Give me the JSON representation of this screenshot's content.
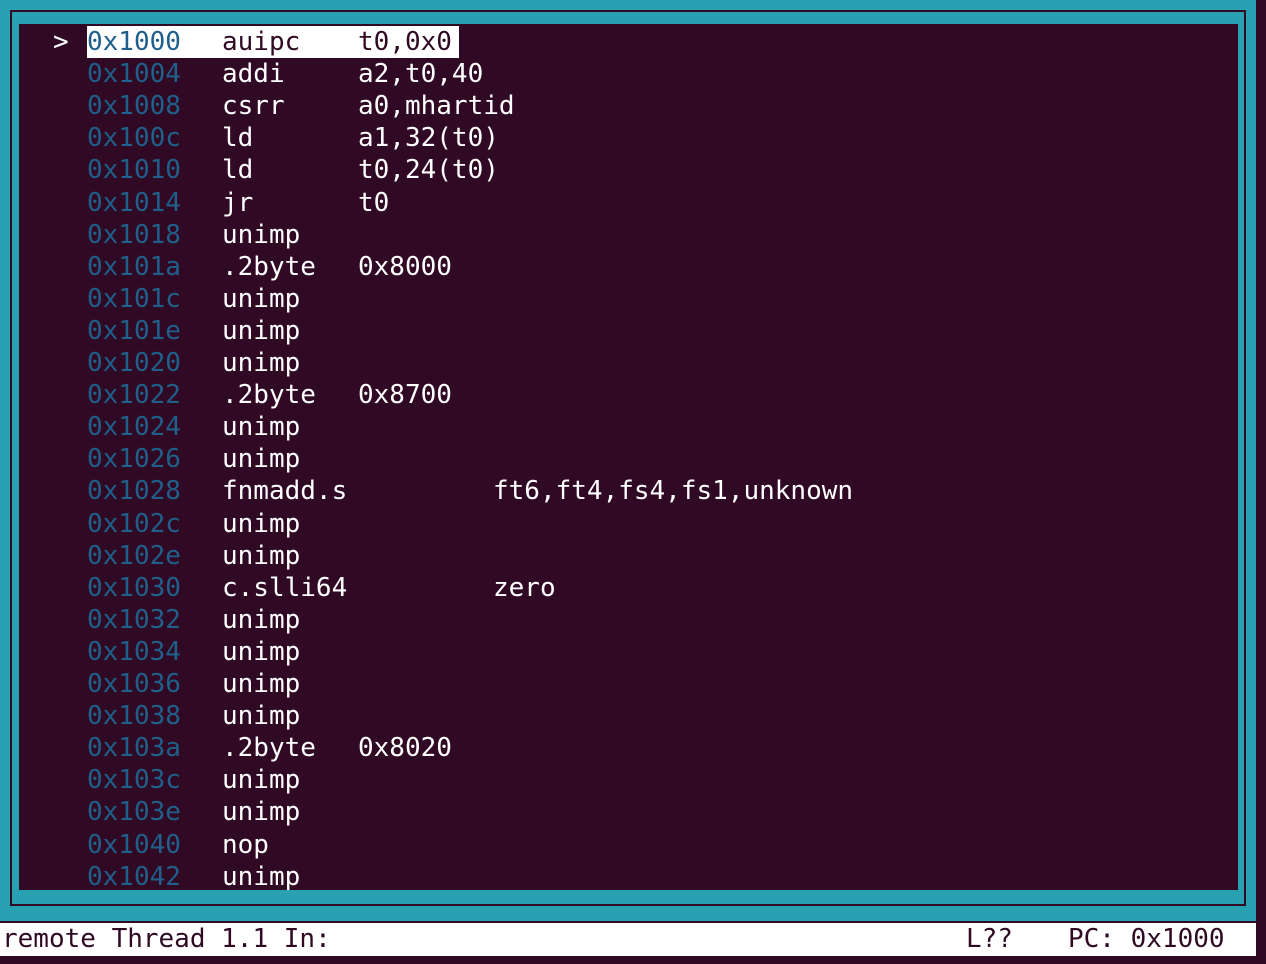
{
  "asm": {
    "pc_marker": ">",
    "lines": [
      {
        "addr": "0x1000",
        "mnem": "auipc",
        "ops": "t0,0x0",
        "current": true
      },
      {
        "addr": "0x1004",
        "mnem": "addi",
        "ops": "a2,t0,40"
      },
      {
        "addr": "0x1008",
        "mnem": "csrr",
        "ops": "a0,mhartid"
      },
      {
        "addr": "0x100c",
        "mnem": "ld",
        "ops": "a1,32(t0)"
      },
      {
        "addr": "0x1010",
        "mnem": "ld",
        "ops": "t0,24(t0)"
      },
      {
        "addr": "0x1014",
        "mnem": "jr",
        "ops": "t0"
      },
      {
        "addr": "0x1018",
        "mnem": "unimp",
        "ops": ""
      },
      {
        "addr": "0x101a",
        "mnem": ".2byte",
        "ops": "0x8000"
      },
      {
        "addr": "0x101c",
        "mnem": "unimp",
        "ops": ""
      },
      {
        "addr": "0x101e",
        "mnem": "unimp",
        "ops": ""
      },
      {
        "addr": "0x1020",
        "mnem": "unimp",
        "ops": ""
      },
      {
        "addr": "0x1022",
        "mnem": ".2byte",
        "ops": "0x8700"
      },
      {
        "addr": "0x1024",
        "mnem": "unimp",
        "ops": ""
      },
      {
        "addr": "0x1026",
        "mnem": "unimp",
        "ops": ""
      },
      {
        "addr": "0x1028",
        "mnem": "fnmadd.s",
        "ops": "ft6,ft4,fs4,fs1,unknown",
        "wide": true
      },
      {
        "addr": "0x102c",
        "mnem": "unimp",
        "ops": ""
      },
      {
        "addr": "0x102e",
        "mnem": "unimp",
        "ops": ""
      },
      {
        "addr": "0x1030",
        "mnem": "c.slli64",
        "ops": "zero",
        "wide": true
      },
      {
        "addr": "0x1032",
        "mnem": "unimp",
        "ops": ""
      },
      {
        "addr": "0x1034",
        "mnem": "unimp",
        "ops": ""
      },
      {
        "addr": "0x1036",
        "mnem": "unimp",
        "ops": ""
      },
      {
        "addr": "0x1038",
        "mnem": "unimp",
        "ops": ""
      },
      {
        "addr": "0x103a",
        "mnem": ".2byte",
        "ops": "0x8020"
      },
      {
        "addr": "0x103c",
        "mnem": "unimp",
        "ops": ""
      },
      {
        "addr": "0x103e",
        "mnem": "unimp",
        "ops": ""
      },
      {
        "addr": "0x1040",
        "mnem": "nop",
        "ops": ""
      },
      {
        "addr": "0x1042",
        "mnem": "unimp",
        "ops": ""
      }
    ]
  },
  "status": {
    "left": "remote Thread 1.1 In:",
    "line": "L??",
    "pc": "PC: 0x1000"
  },
  "colors": {
    "background": "#300a24",
    "frame": "#2aa1b3",
    "address": "#1f5f8a",
    "text": "#ffffff"
  }
}
